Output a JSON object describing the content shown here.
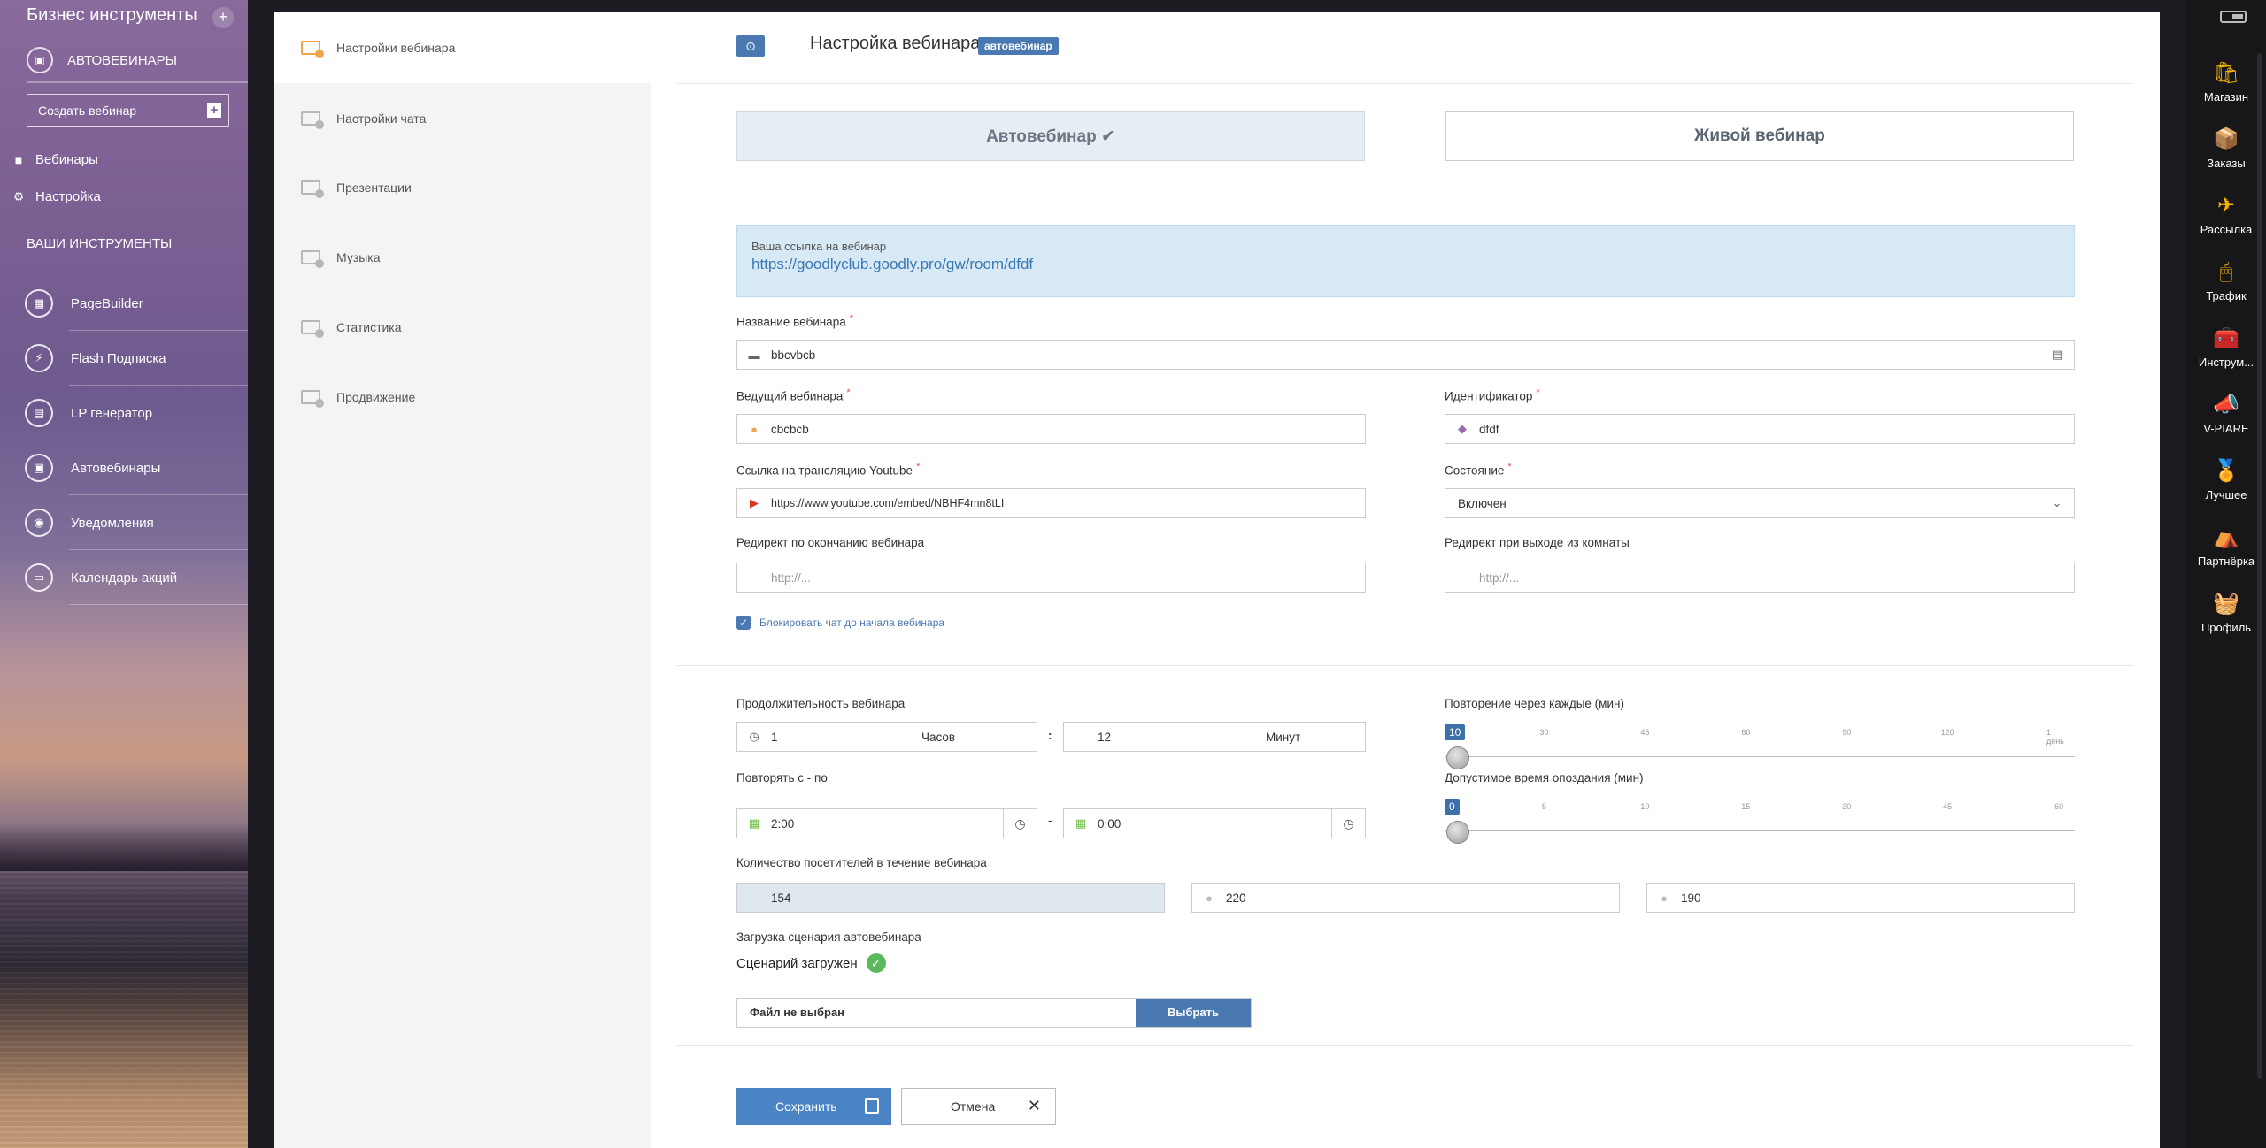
{
  "sidebar": {
    "title": "Бизнес инструменты",
    "plus": "+",
    "section": "АВТОВЕБИНАРЫ",
    "create_button": "Создать вебинар",
    "create_add": "+",
    "links": [
      {
        "label": "Вебинары",
        "icon": "video-icon"
      },
      {
        "label": "Настройка",
        "icon": "gear-icon"
      }
    ],
    "tools_heading": "ВАШИ ИНСТРУМЕНТЫ",
    "tools": [
      {
        "label": "PageBuilder",
        "icon": "pagebuilder-icon"
      },
      {
        "label": "Flash Подписка",
        "icon": "flash-icon"
      },
      {
        "label": "LP генератор",
        "icon": "lp-icon"
      },
      {
        "label": "Автовебинары",
        "icon": "webinar-icon"
      },
      {
        "label": "Уведомления",
        "icon": "notification-icon"
      },
      {
        "label": "Календарь акций",
        "icon": "calendar-icon"
      }
    ]
  },
  "tabs": [
    {
      "label": "Настройки вебинара",
      "active": true
    },
    {
      "label": "Настройки чата",
      "active": false
    },
    {
      "label": "Презентации",
      "active": false
    },
    {
      "label": "Музыка",
      "active": false
    },
    {
      "label": "Статистика",
      "active": false
    },
    {
      "label": "Продвижение",
      "active": false
    }
  ],
  "header": {
    "title": "Настройка вебинара",
    "badge": "автовебинар"
  },
  "mode": {
    "auto": "Автовебинар ✔",
    "live": "Живой вебинар"
  },
  "link": {
    "label": "Ваша ссылка на вебинар",
    "url": "https://goodlyclub.goodly.pro/gw/room/dfdf"
  },
  "form": {
    "name": {
      "label": "Название вебинара",
      "value": "bbcvbcb"
    },
    "host": {
      "label": "Ведущий вебинара",
      "value": "cbcbcb"
    },
    "identifier": {
      "label": "Идентификатор",
      "value": "dfdf"
    },
    "youtube": {
      "label": "Ссылка на трансляцию Youtube",
      "value": "https://www.youtube.com/embed/NBHF4mn8tLI"
    },
    "state": {
      "label": "Состояние",
      "value": "Включен"
    },
    "redirect_end": {
      "label": "Редирект по окончанию вебинара",
      "placeholder": "http://..."
    },
    "redirect_exit": {
      "label": "Редирект при выходе из комнаты",
      "placeholder": "http://..."
    },
    "block_chat": "Блокировать чат до начала вебинара",
    "duration": {
      "label": "Продолжительность вебинара",
      "hours": "1",
      "hours_unit": "Часов",
      "sep": ":",
      "minutes": "12",
      "minutes_unit": "Минут"
    },
    "repeat": {
      "label": "Повторять с - по",
      "from": "2:00",
      "dash": "-",
      "to": "0:00"
    },
    "repeat_every": {
      "label": "Повторение через каждые (мин)",
      "value": "10",
      "ticks": [
        "30",
        "45",
        "60",
        "90",
        "120",
        "1 день"
      ]
    },
    "late": {
      "label": "Допустимое время опоздания (мин)",
      "value": "0",
      "ticks": [
        "5",
        "10",
        "15",
        "30",
        "45",
        "60"
      ]
    },
    "visitors": {
      "label": "Количество посетителей в течение вебинара",
      "values": [
        "154",
        "220",
        "190"
      ]
    },
    "scenario": {
      "label": "Загрузка сценария автовебинара",
      "status": "Сценарий загружен"
    },
    "file": {
      "name": "Файл не выбран",
      "button": "Выбрать"
    }
  },
  "actions": {
    "save": "Сохранить",
    "cancel": "Отмена"
  },
  "dock": [
    {
      "label": "Магазин",
      "icon": "shop-icon"
    },
    {
      "label": "Заказы",
      "icon": "orders-icon"
    },
    {
      "label": "Рассылка",
      "icon": "mailing-icon"
    },
    {
      "label": "Трафик",
      "icon": "traffic-icon"
    },
    {
      "label": "Инструм...",
      "icon": "tools-icon"
    },
    {
      "label": "V-PIARE",
      "icon": "megaphone-icon"
    },
    {
      "label": "Лучшее",
      "icon": "best-icon"
    },
    {
      "label": "Партнёрка",
      "icon": "partner-icon"
    },
    {
      "label": "Профиль",
      "icon": "profile-icon"
    }
  ],
  "colors": {
    "accent": "#4a79b2",
    "tab_active": "#f0a54b",
    "success": "#5cb85c",
    "required": "#d9534f"
  }
}
